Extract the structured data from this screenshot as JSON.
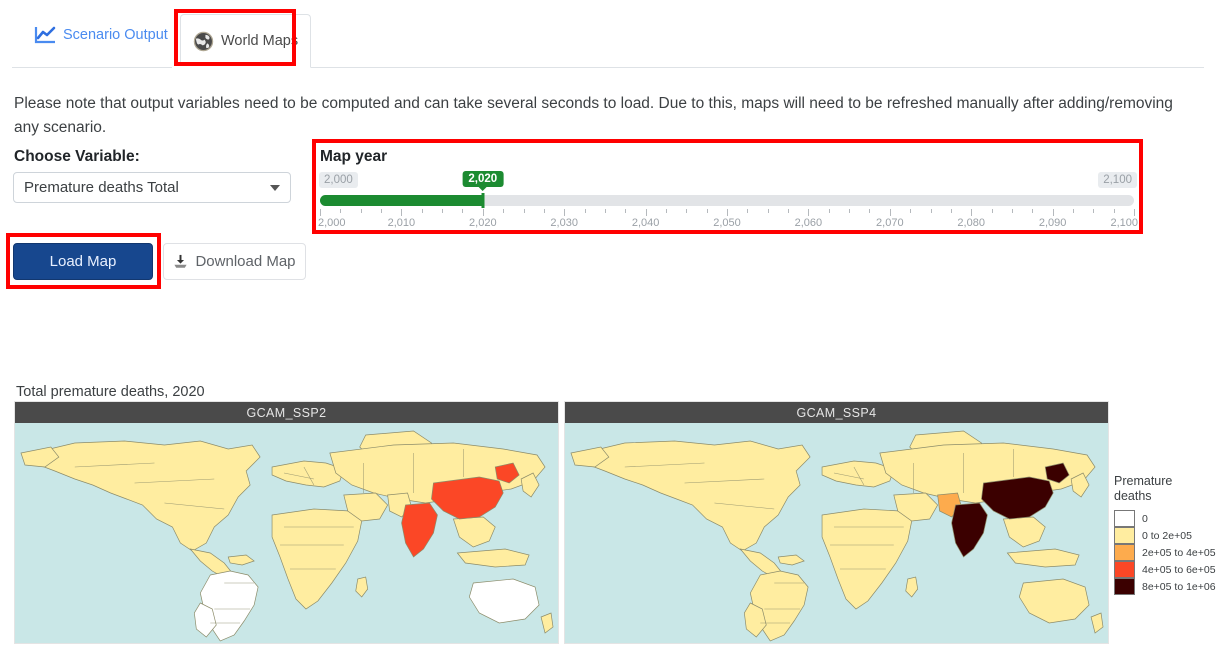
{
  "tabs": [
    {
      "id": "scenario-output",
      "label": "Scenario Output",
      "icon": "line-chart-icon",
      "active": false
    },
    {
      "id": "world-maps",
      "label": "World Maps",
      "icon": "globe-icon",
      "active": true
    }
  ],
  "note": "Please note that output variables need to be computed and can take several seconds to load. Due to this, maps will need to be refreshed manually after adding/removing any scenario.",
  "controls": {
    "choose_variable_label": "Choose Variable:",
    "variable_selected": "Premature deaths Total",
    "dropdown_icon": "chevron-down-icon",
    "load_map_label": "Load Map",
    "download_map_label": "Download Map",
    "download_icon": "download-icon"
  },
  "slider": {
    "title": "Map year",
    "min_label": "2,000",
    "max_label": "2,100",
    "value_label": "2,020",
    "min": 2000,
    "max": 2100,
    "value": 2020,
    "step": 5,
    "tick_labels": [
      "2,000",
      "2,010",
      "2,020",
      "2,030",
      "2,040",
      "2,050",
      "2,060",
      "2,070",
      "2,080",
      "2,090",
      "2,100"
    ],
    "tick_values": [
      2000,
      2010,
      2020,
      2030,
      2040,
      2050,
      2060,
      2070,
      2080,
      2090,
      2100
    ],
    "minor_tick_values": [
      2002.5,
      2005,
      2007.5,
      2012.5,
      2015,
      2017.5,
      2022.5,
      2025,
      2027.5,
      2032.5,
      2035,
      2037.5,
      2042.5,
      2045,
      2047.5,
      2052.5,
      2055,
      2057.5,
      2062.5,
      2065,
      2067.5,
      2072.5,
      2075,
      2077.5,
      2082.5,
      2085,
      2087.5,
      2092.5,
      2095,
      2097.5
    ],
    "fill_color": "#1c8b31",
    "track_color": "#e2e4e7"
  },
  "maps": {
    "title": "Total premature deaths, 2020",
    "panels": [
      {
        "header": "GCAM_SSP2"
      },
      {
        "header": "GCAM_SSP4"
      }
    ]
  },
  "legend": {
    "title_line1": "Premature",
    "title_line2": "deaths",
    "items": [
      {
        "label": "0",
        "color": "#ffffff"
      },
      {
        "label": "0 to 2e+05",
        "color": "#ffeda0"
      },
      {
        "label": "2e+05 to 4e+05",
        "color": "#fdab4d"
      },
      {
        "label": "4e+05 to 6e+05",
        "color": "#fb4726"
      },
      {
        "label": "8e+05 to 1e+06",
        "color": "#3b0000"
      }
    ]
  },
  "annotations": {
    "highlight_color": "#ff0000",
    "boxes": [
      "world-maps-tab",
      "map-year-slider",
      "load-map-button"
    ]
  },
  "chart_data": {
    "type": "map",
    "title": "Total premature deaths, 2020",
    "year": 2020,
    "variable": "Premature deaths Total",
    "legend_title": "Premature deaths",
    "bins": [
      "0",
      "0 to 2e+05",
      "2e+05 to 4e+05",
      "4e+05 to 6e+05",
      "8e+05 to 1e+06"
    ],
    "bin_colors": [
      "#ffffff",
      "#ffeda0",
      "#fdab4d",
      "#fb4726",
      "#3b0000"
    ],
    "panels": [
      {
        "name": "GCAM_SSP2",
        "regions": [
          {
            "name": "China",
            "bin": "4e+05 to 6e+05",
            "color": "#fb4726"
          },
          {
            "name": "India",
            "bin": "4e+05 to 6e+05",
            "color": "#fb4726"
          },
          {
            "name": "Brazil",
            "bin": "0",
            "color": "#ffffff"
          },
          {
            "name": "Argentina",
            "bin": "0",
            "color": "#ffffff"
          },
          {
            "name": "Australia",
            "bin": "0",
            "color": "#ffffff"
          },
          {
            "name": "Rest of world",
            "bin": "0 to 2e+05",
            "color": "#ffeda0"
          }
        ]
      },
      {
        "name": "GCAM_SSP4",
        "regions": [
          {
            "name": "China",
            "bin": "8e+05 to 1e+06",
            "color": "#3b0000"
          },
          {
            "name": "India",
            "bin": "8e+05 to 1e+06",
            "color": "#3b0000"
          },
          {
            "name": "Pakistan",
            "bin": "2e+05 to 4e+05",
            "color": "#fdab4d"
          },
          {
            "name": "Rest of world",
            "bin": "0 to 2e+05",
            "color": "#ffeda0"
          }
        ]
      }
    ]
  }
}
